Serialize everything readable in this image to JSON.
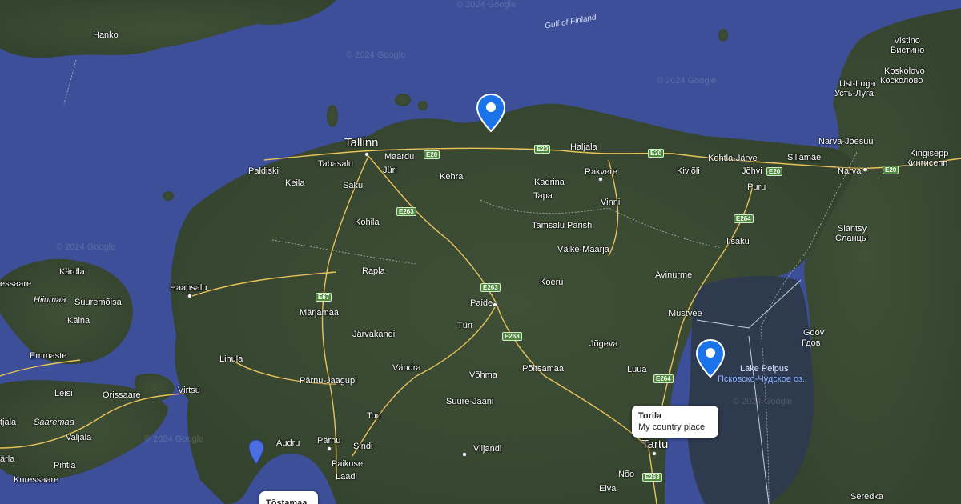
{
  "map": {
    "watermark": "© 2024 Google",
    "sea_labels": {
      "gulf": "Gulf of Finland"
    },
    "places": {
      "tallinn": "Tallinn",
      "hanko": "Hanko",
      "vistino": "Vistino",
      "vistino_ru": "Вистино",
      "koskolovo": "Koskolovo",
      "koskolovo_ru": "Косколово",
      "ust_luga": "Ust-Luga",
      "ust_luga_ru": "Усть-Луга",
      "narva_joesuu": "Narva-Jõesuu",
      "kingisepp": "Kingisepp",
      "kingisepp_ru": "Кингисепп",
      "maardu": "Maardu",
      "haljala": "Haljala",
      "kohtla_jarve": "Kohtla-Järve",
      "sillamae": "Sillamäe",
      "paldiski": "Paldiski",
      "tabasalu": "Tabasalu",
      "juri": "Jüri",
      "kehra": "Kehra",
      "kadrina": "Kadrina",
      "rakvere": "Rakvere",
      "kivioli": "Kiviõli",
      "johvi": "Jõhvi",
      "narva": "Narva",
      "keila": "Keila",
      "saku": "Saku",
      "tapa": "Tapa",
      "vinni": "Vinni",
      "puru": "Puru",
      "kohila": "Kohila",
      "tamsalu": "Tamsalu Parish",
      "slantsy": "Slantsy",
      "slantsy_ru": "Сланцы",
      "iisaku": "Iisaku",
      "vaike_maarja": "Väike-Maarja",
      "kardla": "Kärdla",
      "kaessaare": "essaare",
      "rapla": "Rapla",
      "avinurme": "Avinurme",
      "koeru": "Koeru",
      "haapsalu": "Haapsalu",
      "hiiumaa": "Hiiumaa",
      "suuremoisa": "Suuremõisa",
      "marjamaa": "Märjamaa",
      "paide": "Paide",
      "mustvee": "Mustvee",
      "kaina": "Käina",
      "jarvakandi": "Järvakandi",
      "turi": "Türi",
      "gdov": "Gdov",
      "gdov_ru": "Гдов",
      "emmaste": "Emmaste",
      "lihula": "Lihula",
      "jogeva": "Jõgeva",
      "vandra": "Vändra",
      "poltsamaa": "Põltsamaa",
      "luua": "Luua",
      "lake_peipus": "Lake Peipus",
      "lake_peipus_ru": "Псковско-Чудское оз.",
      "parnu_jaagupi": "Pärnu-Jaagupi",
      "vohma": "Võhma",
      "leisi": "Leisi",
      "orissaare": "Orissaare",
      "virtsu": "Virtsu",
      "suure_jaani": "Suure-Jaani",
      "tjala": "tjala",
      "saaremaa": "Saaremaa",
      "tori": "Tori",
      "valjala": "Valjala",
      "audru": "Audru",
      "parnu": "Pärnu",
      "sindi": "Sindi",
      "viljandi": "Viljandi",
      "tartu": "Tartu",
      "arla": "ärla",
      "pihtla": "Pihtla",
      "paikuse": "Paikuse",
      "kuressaare": "Kuressaare",
      "laadi": "Laadi",
      "noo": "Nõo",
      "elva": "Elva",
      "seredka": "Seredka"
    },
    "road_shields": [
      "E20",
      "E20",
      "E20",
      "E20",
      "E20",
      "E263",
      "E264",
      "E67",
      "E263",
      "E263",
      "E264",
      "E263"
    ],
    "markers": [
      {
        "name": "marker-north-coast",
        "color": "#1a73e8"
      },
      {
        "name": "marker-lake-peipus",
        "color": "#1a73e8"
      },
      {
        "name": "marker-tostamaa",
        "color": "#4b6fe0"
      }
    ],
    "info_windows": {
      "torila": {
        "title": "Torila",
        "description": "My country place"
      },
      "tostamaa": {
        "title": "Tõstamaa"
      }
    },
    "colors": {
      "sea": "#3c4f98",
      "land": "#3a4a33",
      "lake": "#2e3a4e",
      "road": "#e8c25a",
      "highway": "#f3d27a"
    }
  }
}
